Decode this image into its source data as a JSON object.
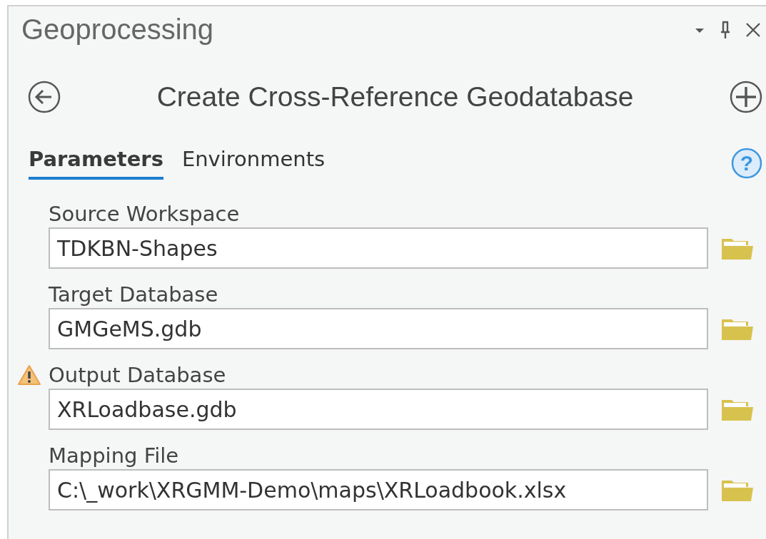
{
  "pane": {
    "title": "Geoprocessing"
  },
  "tool": {
    "title": "Create Cross-Reference Geodatabase"
  },
  "tabs": [
    {
      "label": "Parameters",
      "selected": true
    },
    {
      "label": "Environments",
      "selected": false
    }
  ],
  "help": {
    "label": "?"
  },
  "parameters": [
    {
      "label": "Source Workspace",
      "value": "TDKBN-Shapes",
      "warning": false
    },
    {
      "label": "Target Database",
      "value": "GMGeMS.gdb",
      "warning": false
    },
    {
      "label": "Output Database",
      "value": "XRLoadbase.gdb",
      "warning": true
    },
    {
      "label": "Mapping File",
      "value": "C:\\_work\\XRGMM-Demo\\maps\\XRLoadbook.xlsx",
      "warning": false
    }
  ]
}
